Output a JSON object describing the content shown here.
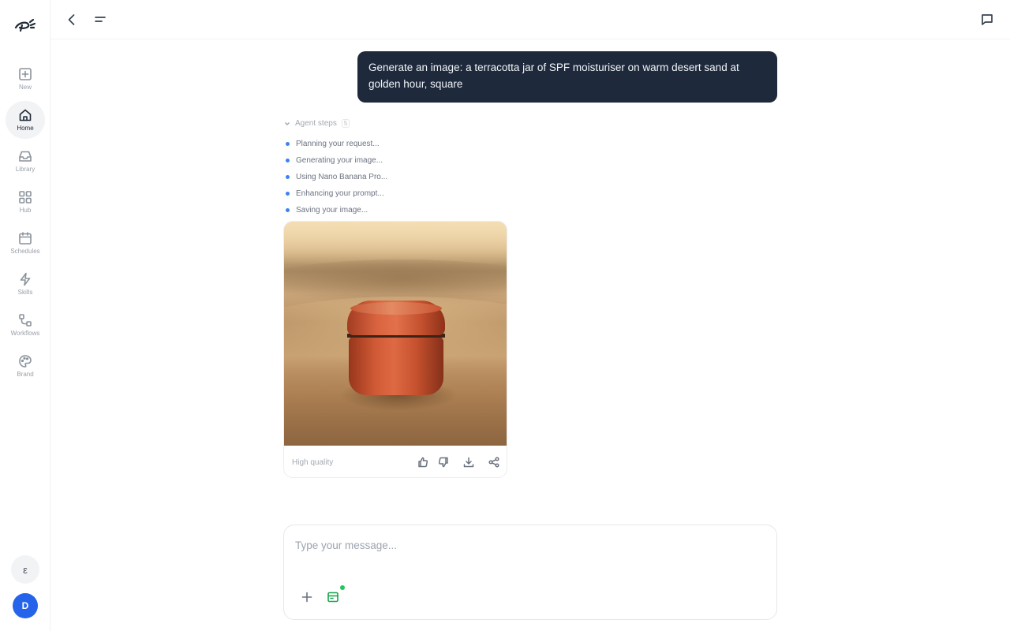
{
  "sidebar": {
    "logo_icon": "brand-logo-icon",
    "items": [
      {
        "label": "New",
        "icon": "plus-square-icon"
      },
      {
        "label": "Home",
        "icon": "home-icon",
        "active": true
      },
      {
        "label": "Library",
        "icon": "inbox-icon"
      },
      {
        "label": "Hub",
        "icon": "grid-icon"
      },
      {
        "label": "Schedules",
        "icon": "calendar-icon"
      },
      {
        "label": "Skills",
        "icon": "lightning-icon"
      },
      {
        "label": "Workflows",
        "icon": "workflow-icon"
      },
      {
        "label": "Brand",
        "icon": "palette-icon"
      }
    ],
    "language_label": "ε",
    "avatar_initial": "D"
  },
  "topbar": {
    "back_icon": "back-chevron-icon",
    "menu_icon": "menu-lines-icon",
    "chat_icon": "chat-bubble-icon"
  },
  "conversation": {
    "user_message": "Generate an image: a terracotta jar of SPF moisturiser on warm desert sand at golden hour, square",
    "agent_steps": {
      "title": "Agent steps",
      "count": "5",
      "steps": [
        "Planning your request...",
        "Generating your image...",
        "Using Nano Banana Pro...",
        "Enhancing your prompt...",
        "Saving your image..."
      ],
      "dot_color": "#3b82f6"
    },
    "image_card": {
      "quality_label": "High quality",
      "actions": [
        "thumbs-up-icon",
        "thumbs-down-icon",
        "download-icon",
        "share-icon"
      ]
    }
  },
  "composer": {
    "placeholder": "Type your message...",
    "value": "",
    "add_icon": "plus-icon",
    "tool_icon": "store-icon",
    "accent": "#16a34a"
  }
}
